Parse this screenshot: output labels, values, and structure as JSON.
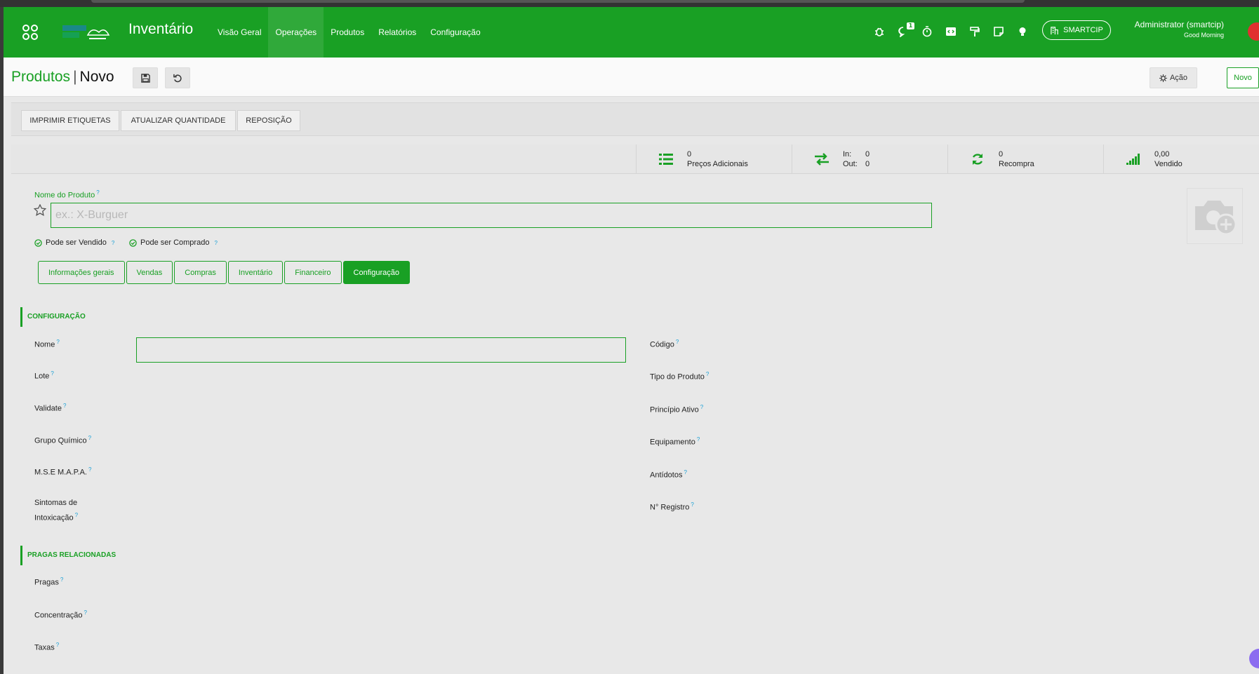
{
  "navbar": {
    "app_title": "Inventário",
    "menu": [
      "Visão Geral",
      "Operações",
      "Produtos",
      "Relatórios",
      "Configuração"
    ],
    "notification_count": "1",
    "company": "SMARTCIP",
    "user_name": "Administrator (smartcip)",
    "greeting": "Good Morning",
    "brand_color": "#19a024"
  },
  "control_panel": {
    "breadcrumb_parent": "Produtos",
    "breadcrumb_sep": "|",
    "breadcrumb_current": "Novo",
    "action_label": "Ação",
    "new_label": "Novo"
  },
  "header_buttons": [
    "IMPRIMIR ETIQUETAS",
    "ATUALIZAR QUANTIDADE",
    "REPOSIÇÃO"
  ],
  "stats": {
    "extra_prices": {
      "value": "0",
      "label": "Preços Adicionais"
    },
    "moves": {
      "in_label": "In:",
      "in_value": "0",
      "out_label": "Out:",
      "out_value": "0"
    },
    "reorder": {
      "value": "0",
      "label": "Recompra"
    },
    "sold": {
      "value": "0,00",
      "label": "Vendido"
    }
  },
  "product": {
    "name_label": "Nome do Produto",
    "help_mark": "?",
    "name_placeholder": "ex.: X-Burguer",
    "can_be_sold": "Pode ser Vendido",
    "can_be_purchased": "Pode ser Comprado"
  },
  "tabs": [
    "Informações gerais",
    "Vendas",
    "Compras",
    "Inventário",
    "Financeiro",
    "Configuração"
  ],
  "active_tab": "Configuração",
  "config_section": {
    "title": "CONFIGURAÇÃO",
    "left_fields": [
      "Nome",
      "Lote",
      "Validate",
      "Grupo Químico",
      "M.S.E M.A.P.A.",
      "Sintomas de Intoxicação"
    ],
    "right_fields": [
      "Código",
      "Tipo do Produto",
      "Princípio Ativo",
      "Equipamento",
      "Antídotos",
      "N° Registro"
    ]
  },
  "pests_section": {
    "title": "PRAGAS RELACIONADAS",
    "fields": [
      "Pragas",
      "Concentração",
      "Taxas"
    ]
  }
}
